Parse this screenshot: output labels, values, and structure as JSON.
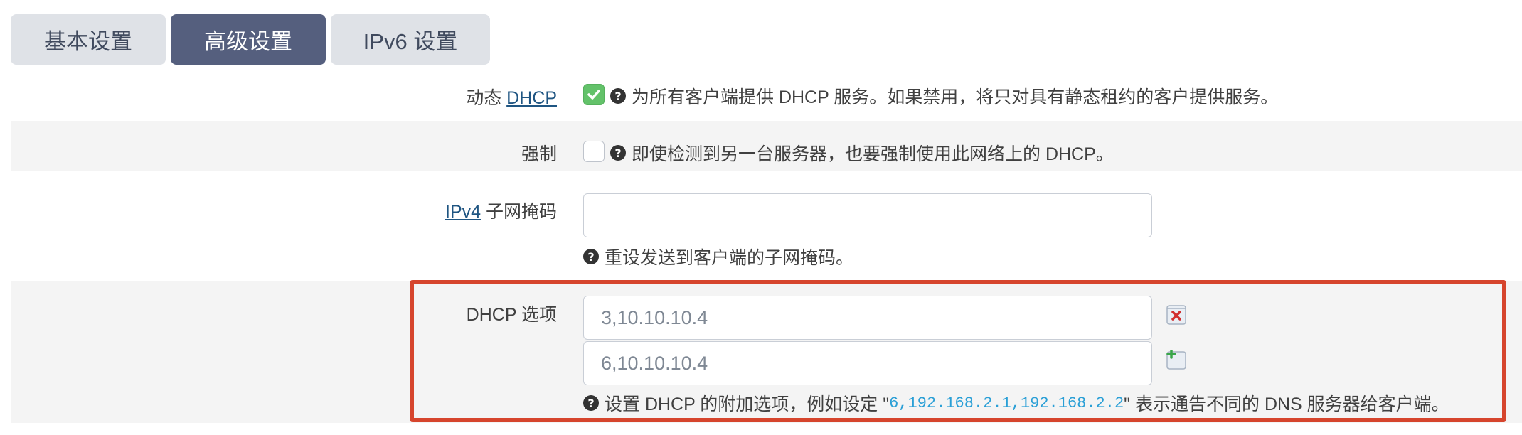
{
  "tabs": [
    {
      "label": "基本设置",
      "active": false
    },
    {
      "label": "高级设置",
      "active": true
    },
    {
      "label": "IPv6 设置",
      "active": false
    }
  ],
  "dynamic_dhcp": {
    "label_prefix": "动态",
    "label_link": "DHCP",
    "checked": true,
    "help": "为所有客户端提供 DHCP 服务。如果禁用，将只对具有静态租约的客户提供服务。"
  },
  "force": {
    "label": "强制",
    "checked": false,
    "help": "即使检测到另一台服务器，也要强制使用此网络上的 DHCP。"
  },
  "netmask": {
    "label_link": "IPv4",
    "label_suffix": "子网掩码",
    "value": "",
    "help": "重设发送到客户端的子网掩码。"
  },
  "dhcp_options": {
    "label": "DHCP 选项",
    "values": [
      "3,10.10.10.4",
      "6,10.10.10.4"
    ],
    "help_prefix": "设置 DHCP 的附加选项，例如设定 \"",
    "help_code": "6,192.168.2.1,192.168.2.2",
    "help_suffix": "\" 表示通告不同的 DNS 服务器给客户端。"
  },
  "colors": {
    "active_tab": "#555f7e",
    "inactive_tab": "#dfe2e7",
    "link": "#1f5582",
    "checked": "#63c26a",
    "highlight": "#d6452d",
    "code": "#2a9fd6"
  },
  "icons": {
    "remove": "remove-value-icon",
    "add": "add-value-icon",
    "help": "help-circle-icon"
  }
}
